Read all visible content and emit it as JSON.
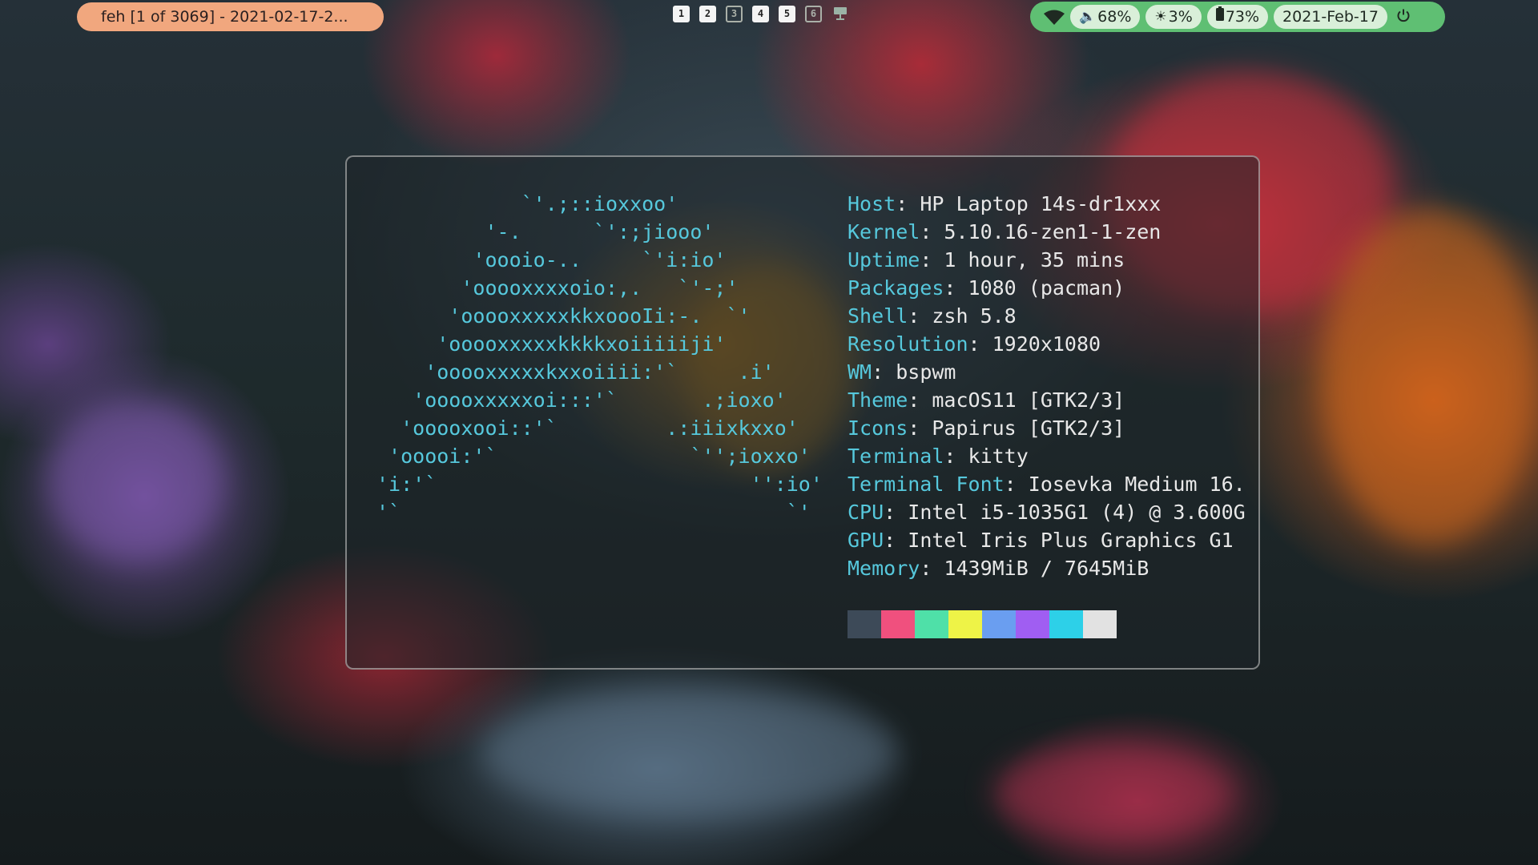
{
  "topbar": {
    "window_title": "feh [1 of 3069] - 2021-02-17-2...",
    "workspaces": [
      "1",
      "2",
      "3",
      "4",
      "5",
      "6"
    ],
    "workspace_states": [
      "active",
      "active",
      "empty",
      "active",
      "active",
      "empty"
    ],
    "extra_icon": "monitor-icon",
    "status": {
      "wifi_icon": "wifi-icon",
      "volume_icon": "volume-icon",
      "volume": "68%",
      "brightness_icon": "sun-icon",
      "brightness": "3%",
      "battery_icon": "battery-icon",
      "battery": "73%",
      "date": "2021-Feb-17",
      "power_icon": "power-icon"
    },
    "colors": {
      "title_bg": "#f1a77e",
      "status_bg": "#5fbf73",
      "pill_bg": "#d9efd9"
    }
  },
  "terminal": {
    "ascii_logo": "            `'.;::ioxxoo'\n         '-.      `':;jiooo'\n        'oooio-..     `'i:io'\n       'ooooxxxxoio:,.   `'-;'\n      'ooooxxxxxkkxoooIi:-.  `'\n     'ooooxxxxxkkkkxoiiiiiji'\n    'ooooxxxxxkxxoiiii:'`     .i'\n   'ooooxxxxxoi:::'`       .;ioxo'\n  'ooooxooi::'`         .:iiixkxxo'\n 'ooooi:'`                `'';ioxxo'\n'i:'`                          '':io'\n'`                                `'",
    "info": [
      {
        "key": "Host",
        "value": "HP Laptop 14s-dr1xxx"
      },
      {
        "key": "Kernel",
        "value": "5.10.16-zen1-1-zen"
      },
      {
        "key": "Uptime",
        "value": "1 hour, 35 mins"
      },
      {
        "key": "Packages",
        "value": "1080 (pacman)"
      },
      {
        "key": "Shell",
        "value": "zsh 5.8"
      },
      {
        "key": "Resolution",
        "value": "1920x1080"
      },
      {
        "key": "WM",
        "value": "bspwm"
      },
      {
        "key": "Theme",
        "value": "macOS11 [GTK2/3]"
      },
      {
        "key": "Icons",
        "value": "Papirus [GTK2/3]"
      },
      {
        "key": "Terminal",
        "value": "kitty"
      },
      {
        "key": "Terminal Font",
        "value": "Iosevka Medium 16."
      },
      {
        "key": "CPU",
        "value": "Intel i5-1035G1 (4) @ 3.600G"
      },
      {
        "key": "GPU",
        "value": "Intel Iris Plus Graphics G1"
      },
      {
        "key": "Memory",
        "value": "1439MiB / 7645MiB"
      }
    ],
    "separator": ": ",
    "palette": [
      "#3d4a58",
      "#f0507e",
      "#4fe0a8",
      "#eef347",
      "#6a9ef0",
      "#a05ef2",
      "#2dd0e8",
      "#e2e2e2"
    ],
    "colors": {
      "key": "#56c8dc",
      "value": "#e8e8e8",
      "logo": "#56c8dc"
    }
  }
}
